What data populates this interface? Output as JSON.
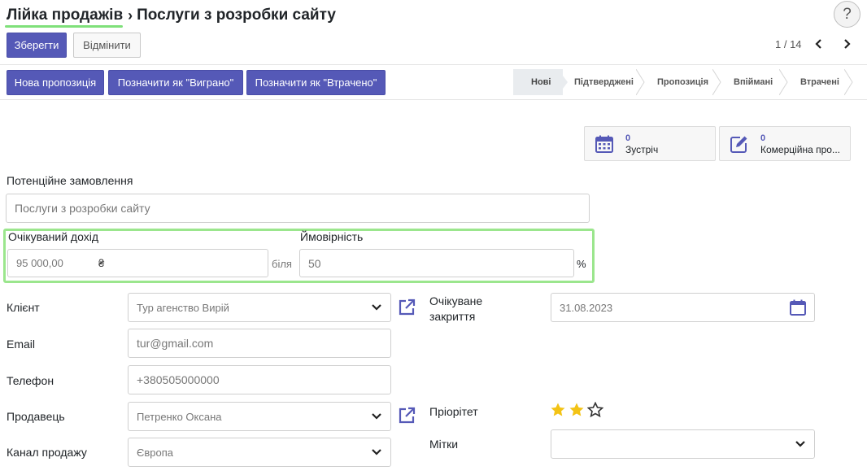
{
  "breadcrumb": {
    "root": "Лійка продажів",
    "separator": "›",
    "current": "Послуги з розробки сайту"
  },
  "help_label": "?",
  "toolbar": {
    "save_label": "Зберегти",
    "discard_label": "Відмінити"
  },
  "pager": {
    "text": "1 / 14"
  },
  "actions": {
    "new_quote": "Нова пропозиція",
    "mark_won": "Позначити як \"Виграно\"",
    "mark_lost": "Позначити як \"Втрачено\""
  },
  "stages": [
    "Нові",
    "Підтверджені",
    "Пропозиція",
    "Впіймані",
    "Втрачені"
  ],
  "active_stage": "Нові",
  "smart_buttons": {
    "meetings": {
      "count": "0",
      "label": "Зустріч"
    },
    "quotes": {
      "count": "0",
      "label": "Комерційна про..."
    }
  },
  "form": {
    "opportunity_label": "Потенційне замовлення",
    "opportunity_value": "Послуги з розробки сайту",
    "revenue_label": "Очікуваний дохід",
    "revenue_value": "95 000,00",
    "currency_symbol": "₴",
    "near_label": "біля",
    "probability_label": "Ймовірність",
    "probability_value": "50",
    "percent_sign": "%",
    "customer_label": "Клієнт",
    "customer_value": "Тур агенство Вирій",
    "email_label": "Email",
    "email_value": "tur@gmail.com",
    "phone_label": "Телефон",
    "phone_value": "+380505000000",
    "salesperson_label": "Продавець",
    "salesperson_value": "Петренко Оксана",
    "channel_label": "Канал продажу",
    "channel_value": "Європа",
    "closing_label": "Очікуване закриття",
    "closing_value": "31.08.2023",
    "priority_label": "Пріорітет",
    "priority_stars": 2,
    "priority_max": 3,
    "tags_label": "Мітки",
    "tags_value": ""
  },
  "colors": {
    "primary": "#5559b7",
    "highlight": "#9be68d",
    "star": "#f3c315"
  },
  "icons": {
    "calendar": "calendar-icon",
    "edit": "edit-icon",
    "external_link": "external-link-icon",
    "dropdown": "chevron-down-icon",
    "star": "star-icon"
  }
}
